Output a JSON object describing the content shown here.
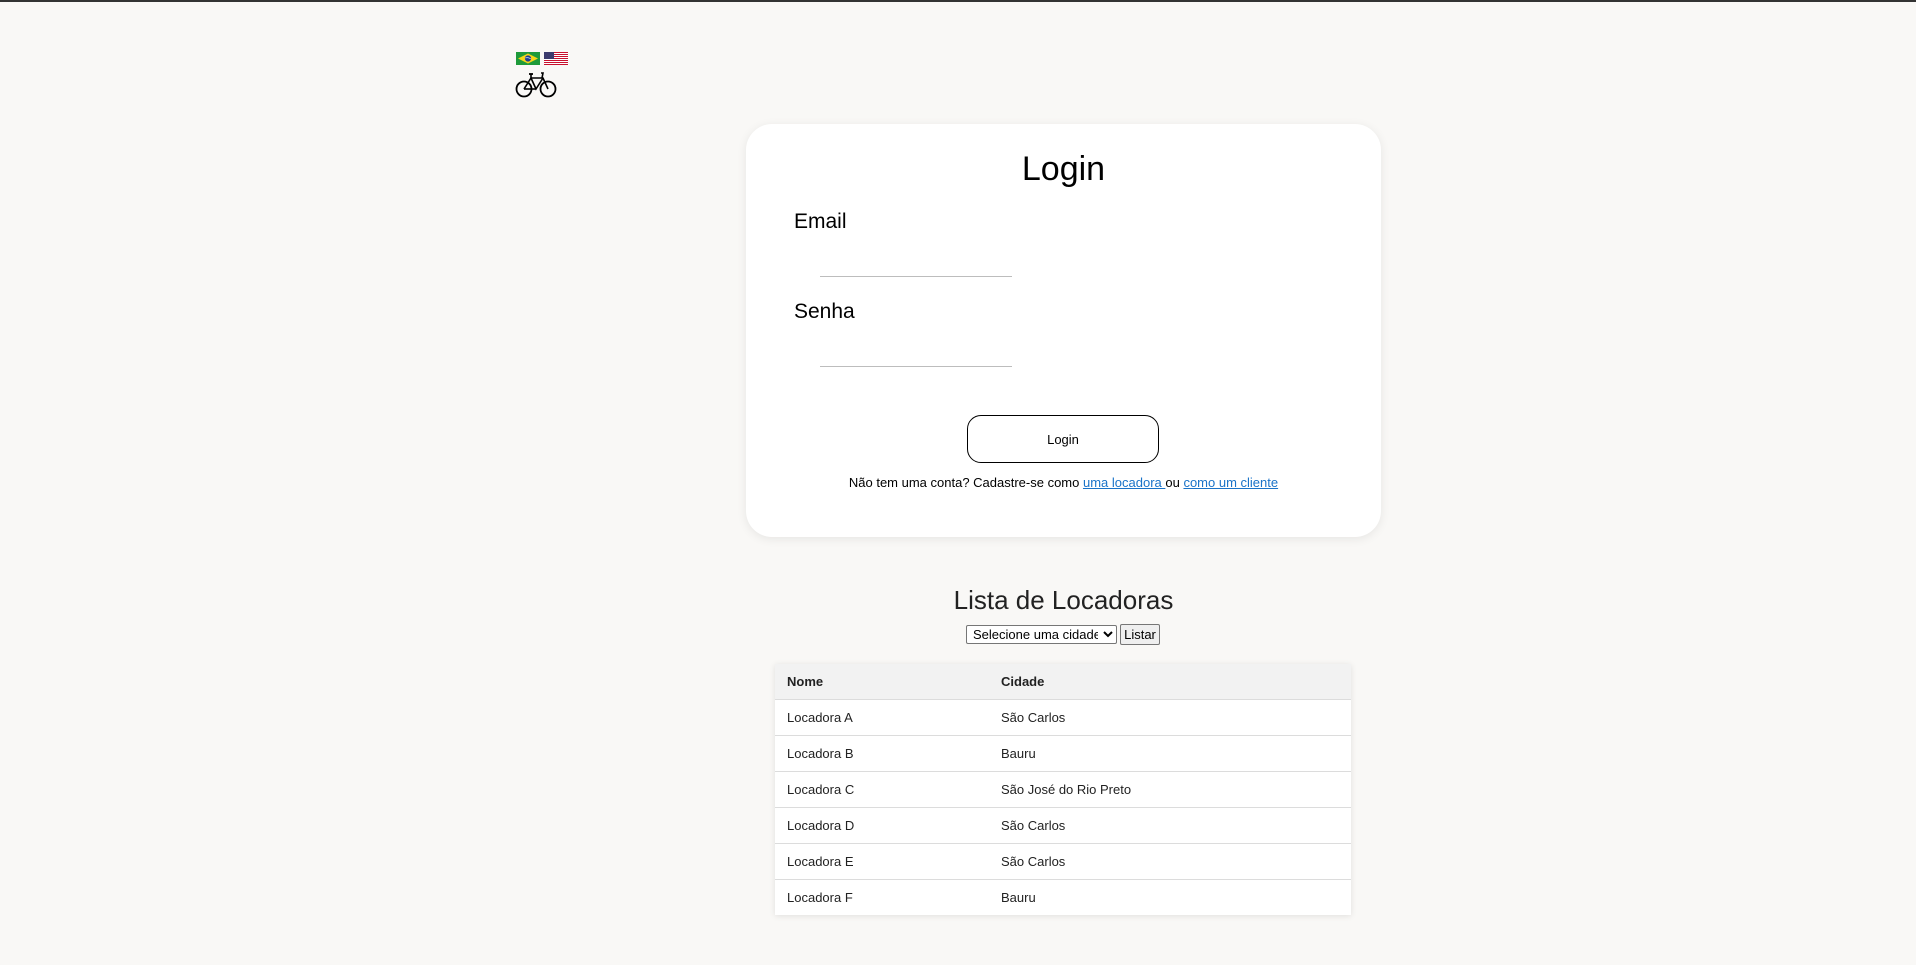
{
  "header": {
    "flags": [
      {
        "icon": "brazil-flag-icon",
        "alt": "Português"
      },
      {
        "icon": "usa-flag-icon",
        "alt": "English"
      }
    ],
    "logo_icon": "bicycle-icon"
  },
  "login": {
    "title": "Login",
    "email_label": "Email",
    "email_value": "",
    "password_label": "Senha",
    "password_value": "",
    "submit_label": "Login",
    "signup_prefix": "Não tem uma conta? Cadastre-se como ",
    "signup_link_rental": "uma locadora ",
    "signup_middle": "ou ",
    "signup_link_client": "como um cliente"
  },
  "list": {
    "title": "Lista de Locadoras",
    "city_select_selected": "Selecione uma cidade",
    "list_button": "Listar",
    "columns": [
      "Nome",
      "Cidade"
    ],
    "rows": [
      {
        "nome": "Locadora A",
        "cidade": "São Carlos"
      },
      {
        "nome": "Locadora B",
        "cidade": "Bauru"
      },
      {
        "nome": "Locadora C",
        "cidade": "São José do Rio Preto"
      },
      {
        "nome": "Locadora D",
        "cidade": "São Carlos"
      },
      {
        "nome": "Locadora E",
        "cidade": "São Carlos"
      },
      {
        "nome": "Locadora F",
        "cidade": "Bauru"
      }
    ]
  },
  "colors": {
    "background": "#f9f8f6",
    "link": "#1a73c8",
    "card": "#ffffff"
  }
}
